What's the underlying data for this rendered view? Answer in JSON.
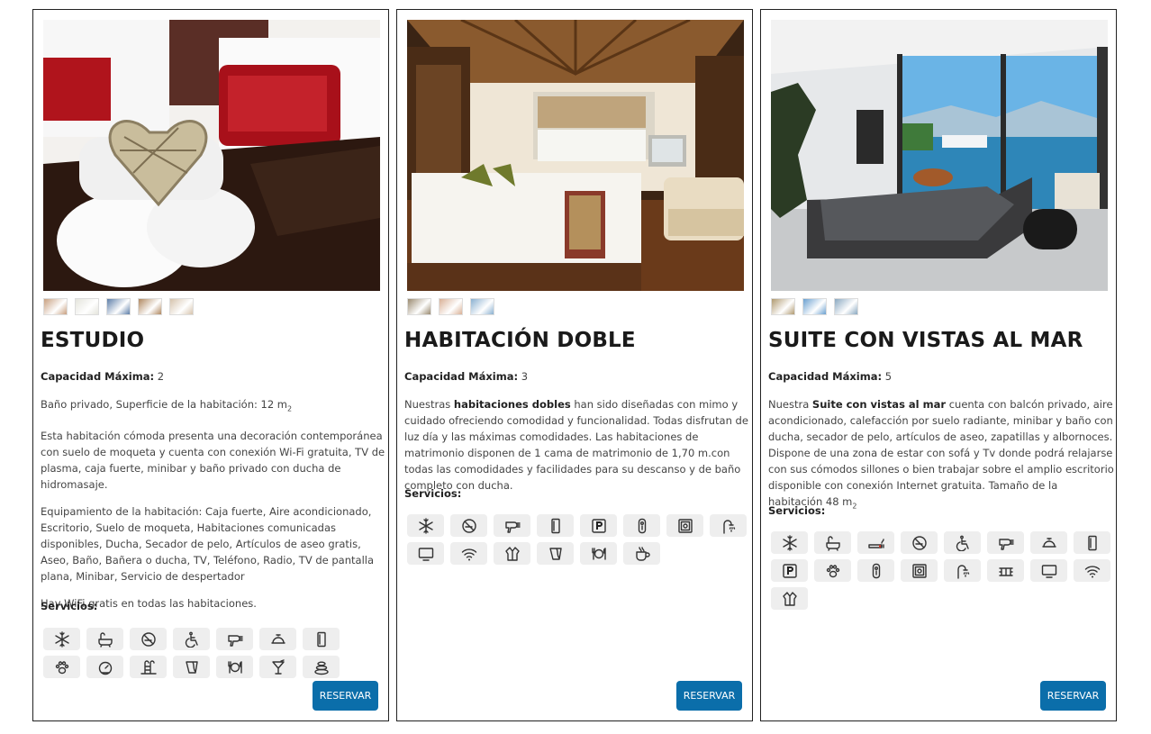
{
  "rooms": [
    {
      "title": "ESTUDIO",
      "capacity_label": "Capacidad Máxima:",
      "capacity_value": "2",
      "bath_line_text": "Baño privado, Superficie de la habitación: 12 m",
      "bath_line_sub": "2",
      "description": "Esta habitación cómoda presenta una decoración contemporánea con suelo de moqueta y cuenta con conexión Wi-Fi gratuita, TV de plasma, caja fuerte, minibar y baño privado con ducha de hidromasaje.",
      "equipment": "Equipamiento de la habitación: Caja fuerte, Aire acondicionado, Escritorio, Suelo de moqueta, Habitaciones comunicadas disponibles, Ducha, Secador de pelo, Artículos de aseo gratis, Aseo, Baño, Bañera o ducha, TV, Teléfono, Radio, TV de pantalla plana, Minibar, Servicio de despertador",
      "wifi_note": "Hay WiFi gratis en todas las habitaciones.",
      "services_label": "Servicios:",
      "services": [
        "snowflake-icon",
        "bathtub-icon",
        "no-smoking-icon",
        "accessible-icon",
        "hairdryer-icon",
        "room-service-icon",
        "door-icon",
        "pet-paw-icon",
        "scale-icon",
        "pool-ladder-icon",
        "sink-icon",
        "dining-icon",
        "cocktail-icon",
        "spa-stones-icon"
      ],
      "thumb_colors": [
        "#c8a080",
        "#e4e4dc",
        "#5d7ea8",
        "#b08860",
        "#d6c3ac"
      ],
      "reserve_label": "RESERVAR"
    },
    {
      "title": "HABITACIÓN DOBLE",
      "capacity_label": "Capacidad Máxima:",
      "capacity_value": "3",
      "desc_pre": "Nuestras ",
      "desc_bold": "habitaciones dobles",
      "desc_post": " han sido diseñadas con mimo y cuidado ofreciendo comodidad y funcionalidad. Todas disfrutan de luz día y las máximas comodidades. Las habitaciones de matrimonio disponen de 1 cama de matrimonio de 1,70 m.con todas las comodidades y facilidades para su descanso y de baño completo con ducha.",
      "services_label": "Servicios:",
      "services": [
        "snowflake-icon",
        "no-smoking-icon",
        "hairdryer-icon",
        "door-icon",
        "parking-icon",
        "key-card-icon",
        "safe-icon",
        "shower-icon",
        "tv-icon",
        "wifi-icon",
        "bathrobe-icon",
        "sink-icon",
        "dining-icon",
        "coffee-icon"
      ],
      "thumb_colors": [
        "#9a8a70",
        "#d9b096",
        "#8ab0d0"
      ],
      "reserve_label": "RESERVAR"
    },
    {
      "title": "SUITE CON VISTAS AL MAR",
      "capacity_label": "Capacidad Máxima:",
      "capacity_value": "5",
      "desc_pre": "Nuestra ",
      "desc_bold": "Suite con vistas al mar",
      "desc_post": " cuenta con balcón privado, aire acondicionado, calefacción por suelo radiante, minibar y baño con ducha, secador de pelo, artículos de aseo, zapatillas y albornoces. Dispone de una zona de estar con sofá y Tv donde podrá relajarse con sus cómodos sillones o bien trabajar sobre el amplio escritorio disponible con conexión Internet gratuita. Tamaño de la habitación 48 m",
      "desc_sub": "2",
      "services_label": "Servicios:",
      "services": [
        "snowflake-icon",
        "bathtub-icon",
        "smoking-icon",
        "no-smoking-icon",
        "accessible-icon",
        "hairdryer-icon",
        "room-service-icon",
        "door-icon",
        "parking-icon",
        "pet-paw-icon",
        "key-card-icon",
        "safe-icon",
        "shower-icon",
        "heater-icon",
        "tv-icon",
        "wifi-icon",
        "bathrobe-icon"
      ],
      "thumb_colors": [
        "#b09a70",
        "#6aa0d0",
        "#8aa8c0"
      ],
      "reserve_label": "RESERVAR"
    }
  ]
}
